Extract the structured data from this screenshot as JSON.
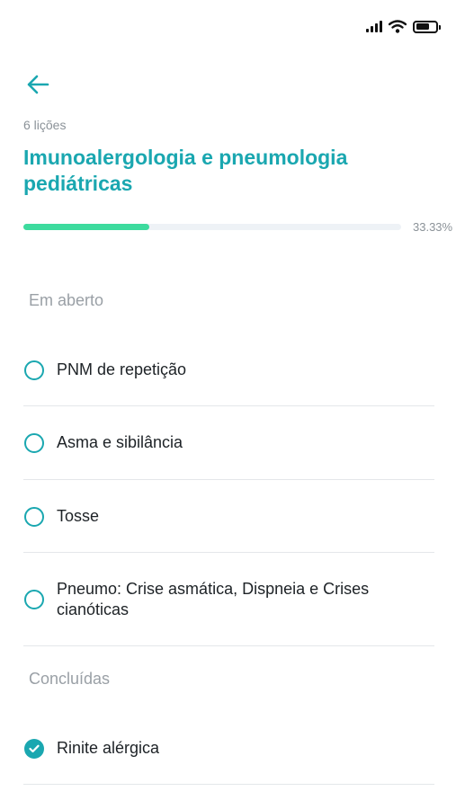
{
  "status_bar": {
    "icons": [
      "signal-icon",
      "wifi-icon",
      "battery-icon"
    ]
  },
  "header": {
    "back_icon": "arrow-left-icon",
    "lesson_count": "6 lições",
    "title": "Imunoalergologia e pneumologia pediátricas"
  },
  "progress": {
    "value_percent": 33.33,
    "label": "33.33%"
  },
  "sections": {
    "open": {
      "label": "Em aberto",
      "items": [
        {
          "label": "PNM de repetição",
          "completed": false
        },
        {
          "label": "Asma e sibilância",
          "completed": false
        },
        {
          "label": "Tosse",
          "completed": false
        },
        {
          "label": "Pneumo: Crise asmática, Dispneia e Crises cianóticas",
          "completed": false
        }
      ]
    },
    "done": {
      "label": "Concluídas",
      "items": [
        {
          "label": "Rinite alérgica",
          "completed": true
        }
      ]
    }
  },
  "colors": {
    "accent": "#1aa7b0",
    "progress": "#3ddb9e",
    "muted_text": "#9aa0a6",
    "divider": "#e4e7ea"
  }
}
